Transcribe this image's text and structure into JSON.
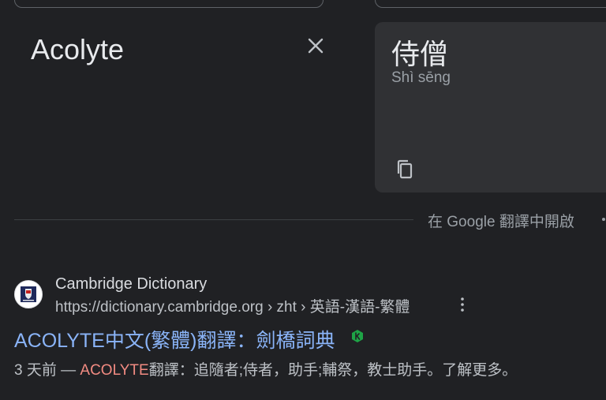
{
  "source": {
    "text": "Acolyte"
  },
  "target": {
    "text": "侍僧",
    "transliteration": "Shì sēng"
  },
  "open_in_translate": "在 Google 翻譯中開啟",
  "result": {
    "site_name": "Cambridge Dictionary",
    "url": "https://dictionary.cambridge.org › zht › 英語-漢語-繁體",
    "title": "ACOLYTE中文(繁體)翻譯：劍橋詞典",
    "snippet_date": "3 天前 — ",
    "snippet_highlight": "ACOLYTE",
    "snippet_rest": "翻譯：追隨者;侍者，助手;輔祭，教士助手。了解更多。"
  },
  "icons": {
    "clear": "close-icon",
    "copy": "copy-icon",
    "more": "more-vert-icon",
    "favicon": "cambridge-logo-icon",
    "badge": "k-badge-icon"
  },
  "colors": {
    "background": "#202124",
    "panel": "#303134",
    "link": "#8ab4f8",
    "highlight": "#f28b82",
    "badge": "#1ea446"
  }
}
